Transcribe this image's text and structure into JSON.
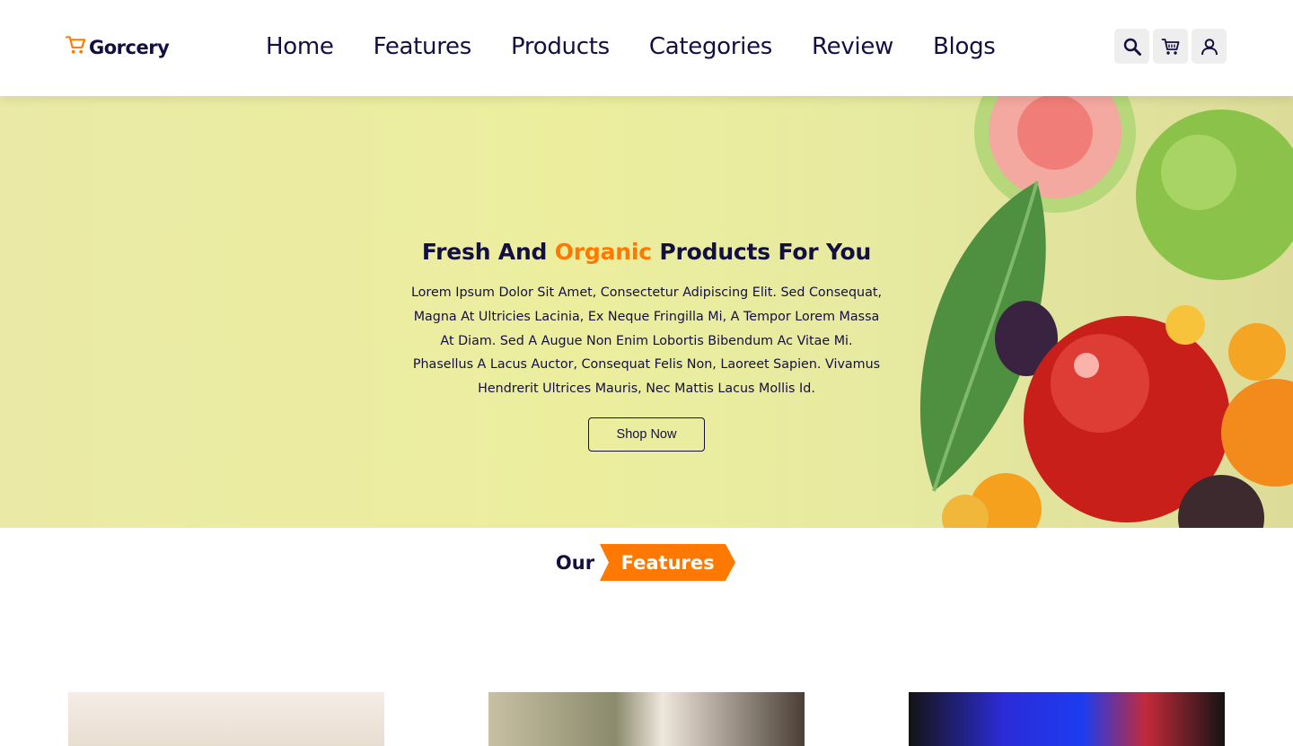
{
  "header": {
    "logo_text": "Gorcery",
    "nav": [
      "Home",
      "Features",
      "Products",
      "Categories",
      "Review",
      "Blogs"
    ],
    "icons": [
      "search-icon",
      "cart-icon",
      "user-icon"
    ]
  },
  "hero": {
    "title_start": "Fresh And ",
    "title_accent": "Organic",
    "title_end": " Products For You",
    "description": "Lorem Ipsum Dolor Sit Amet, Consectetur Adipiscing Elit. Sed Consequat, Magna At Ultricies Lacinia, Ex Neque Fringilla Mi, A Tempor Lorem Massa At Diam. Sed A Augue Non Enim Lobortis Bibendum Ac Vitae Mi. Phasellus A Lacus Auctor, Consequat Felis Non, Laoreet Sapien. Vivamus Hendrerit Ultrices Mauris, Nec Mattis Lacus Mollis Id.",
    "button_label": "Shop Now"
  },
  "features": {
    "heading_prefix": "Our",
    "heading_highlight": "Features"
  },
  "colors": {
    "primary": "#130f40",
    "accent": "#ff7800",
    "hero_bg": "#eaeca3",
    "icon_bg": "#eeeeee"
  }
}
